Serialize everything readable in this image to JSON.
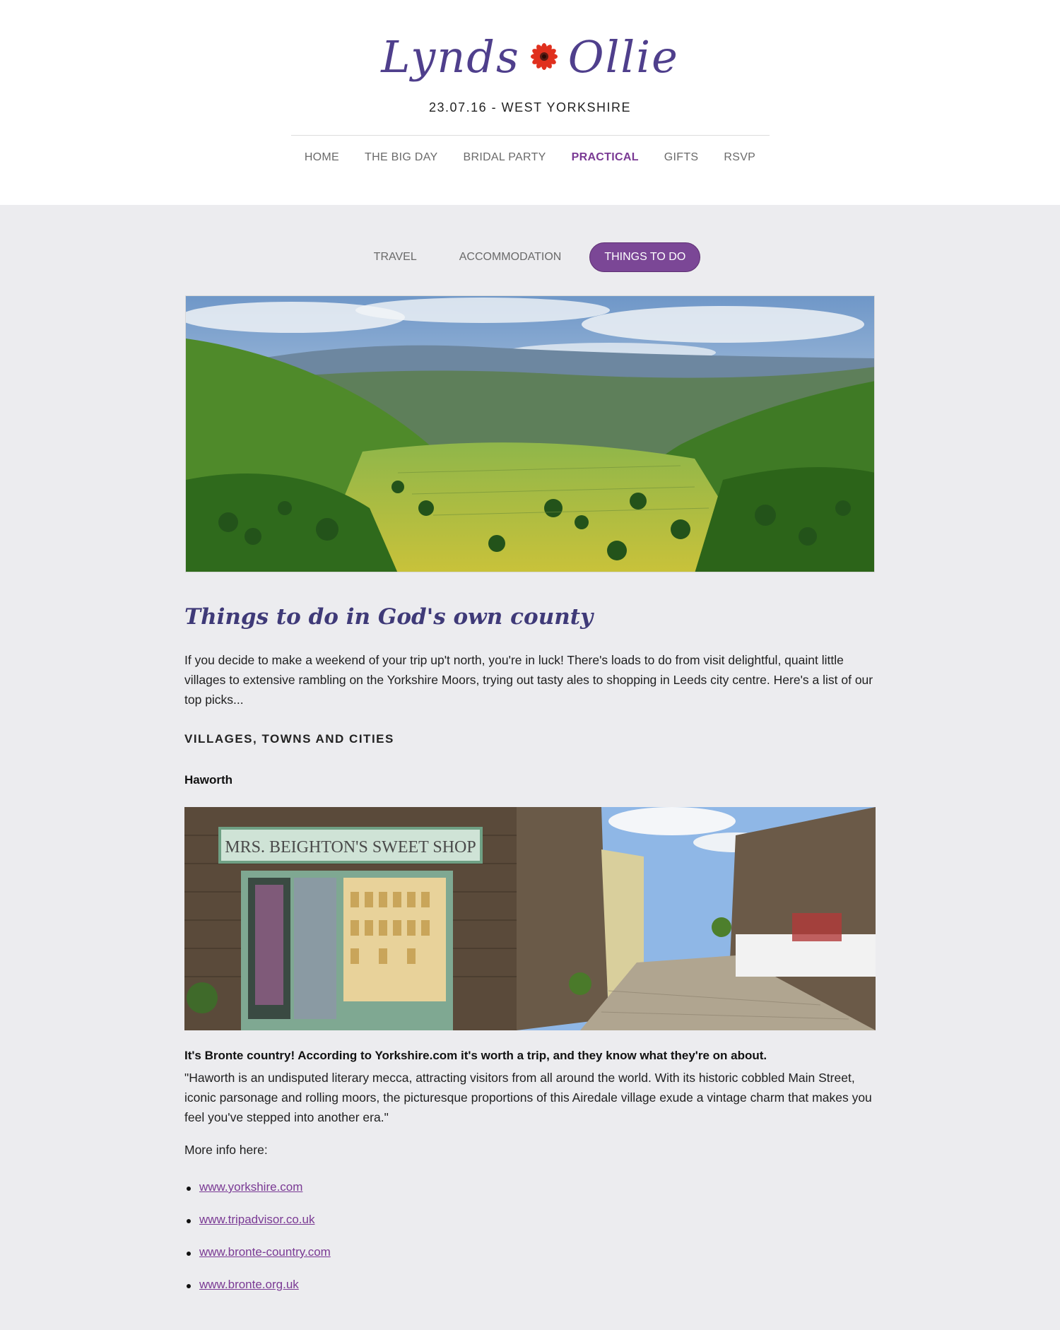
{
  "logo": {
    "left_name": "Lynds",
    "right_name": "Ollie",
    "flower_icon": "flower-icon",
    "color": "#4f3f8c"
  },
  "tagline": "23.07.16 - WEST YORKSHIRE",
  "main_nav": [
    {
      "label": "HOME",
      "active": false
    },
    {
      "label": "THE BIG DAY",
      "active": false
    },
    {
      "label": "BRIDAL PARTY",
      "active": false
    },
    {
      "label": "PRACTICAL",
      "active": true
    },
    {
      "label": "GIFTS",
      "active": false
    },
    {
      "label": "RSVP",
      "active": false
    }
  ],
  "sub_nav": [
    {
      "label": "TRAVEL",
      "active": false
    },
    {
      "label": "ACCOMMODATION",
      "active": false
    },
    {
      "label": "THINGS TO DO",
      "active": true
    }
  ],
  "content": {
    "title": "Things to do in God's own county",
    "intro": "If you decide to make a weekend of your trip up't north, you're in luck! There's loads to do from visit delightful, quaint little villages to extensive rambling on the Yorkshire Moors, trying out tasty ales to shopping in Leeds city centre. Here's a list of our top picks...",
    "category": "VILLAGES, TOWNS AND CITIES",
    "place": "Haworth",
    "photo_sign": "MRS. BEIGHTON'S SWEET SHOP",
    "quote_lead": "It's Bronte country! According to Yorkshire.com it's worth a trip, and they know what they're on about.",
    "quote": "\"Haworth is an undisputed literary mecca, attracting visitors from all around the world. With its historic cobbled Main Street, iconic parsonage and rolling moors, the picturesque proportions of this Airedale village exude a vintage charm that makes you feel you've stepped into another era.\"",
    "more_info": "More info here:",
    "links": [
      "www.yorkshire.com",
      "www.tripadvisor.co.uk",
      "www.bronte-country.com",
      "www.bronte.org.uk"
    ]
  },
  "colors": {
    "accent": "#7b4796",
    "background": "#ececef",
    "header_bg": "#ffffff"
  }
}
